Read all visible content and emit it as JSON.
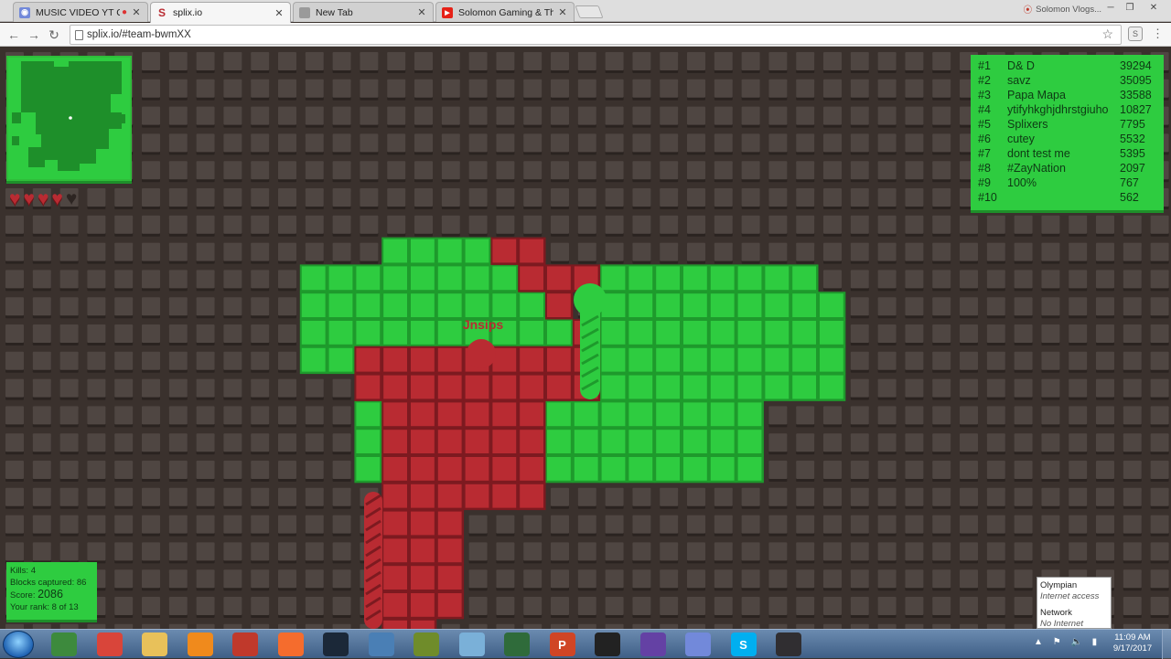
{
  "browser": {
    "tabs": [
      {
        "title": "MUSIC VIDEO YT CHA",
        "icon": "discord-icon",
        "color": "#7289da",
        "active": false,
        "audio": true
      },
      {
        "title": "splix.io",
        "icon": "splix-icon",
        "color": "#b92b32",
        "active": true,
        "audio": false
      },
      {
        "title": "New Tab",
        "icon": "new-tab-icon",
        "color": "#888888",
        "active": false,
        "audio": false
      },
      {
        "title": "Solomon Gaming & Thi",
        "icon": "youtube-icon",
        "color": "#e62117",
        "active": false,
        "audio": false
      }
    ],
    "profile_name": "Solomon Vlogs...",
    "url": "splix.io/#team-bwmXX",
    "extension_label": "S"
  },
  "game": {
    "colors": {
      "background": "#3a312d",
      "green": "#2ecc40",
      "green_dark": "#1e9a2c",
      "red": "#b92b32",
      "red_dark": "#7d1a20"
    },
    "player_name": "Jnsips",
    "lives_total": 5,
    "lives_remaining": 4,
    "leaderboard": [
      {
        "rank": "#1",
        "name": "D& D",
        "score": "39294"
      },
      {
        "rank": "#2",
        "name": "savz",
        "score": "35095"
      },
      {
        "rank": "#3",
        "name": "Papa Mapa",
        "score": "33588"
      },
      {
        "rank": "#4",
        "name": "ytifyhkghjdhrstgiuho",
        "score": "10827"
      },
      {
        "rank": "#5",
        "name": "Splixers",
        "score": "7795"
      },
      {
        "rank": "#6",
        "name": "cutey",
        "score": "5532"
      },
      {
        "rank": "#7",
        "name": "dont test me",
        "score": "5395"
      },
      {
        "rank": "#8",
        "name": "#ZayNation",
        "score": "2097"
      },
      {
        "rank": "#9",
        "name": "100%",
        "score": "767"
      },
      {
        "rank": "#10",
        "name": "",
        "score": "562"
      }
    ],
    "stats": {
      "kills": "Kills: 4",
      "blocks": "Blocks captured: 86",
      "score_label": "Score:",
      "score_value": "2086",
      "rank": "Your rank: 8 of 13"
    }
  },
  "network_tooltip": {
    "name1": "Olympian",
    "status1": "Internet access",
    "name2": "Network",
    "status2": "No Internet access"
  },
  "taskbar": {
    "apps": [
      {
        "icon": "tree-icon",
        "color": "#3d8a3d",
        "label": ""
      },
      {
        "icon": "chrome-icon",
        "color": "#d9453a",
        "label": ""
      },
      {
        "icon": "folder-icon",
        "color": "#e8c15a",
        "label": ""
      },
      {
        "icon": "media-player-icon",
        "color": "#f08a1c",
        "label": ""
      },
      {
        "icon": "snipping-tool-icon",
        "color": "#c0392b",
        "label": ""
      },
      {
        "icon": "origin-icon",
        "color": "#f56c2d",
        "label": ""
      },
      {
        "icon": "steam-icon",
        "color": "#1b2838",
        "label": ""
      },
      {
        "icon": "network-settings-icon",
        "color": "#4a7fb5",
        "label": ""
      },
      {
        "icon": "game-character-icon",
        "color": "#6f8c2a",
        "label": ""
      },
      {
        "icon": "paint-icon",
        "color": "#7ab0d8",
        "label": ""
      },
      {
        "icon": "game-window-icon",
        "color": "#2f6b3a",
        "label": ""
      },
      {
        "icon": "powerpoint-icon",
        "color": "#d04525",
        "label": "P"
      },
      {
        "icon": "stick-figure-icon",
        "color": "#222222",
        "label": ""
      },
      {
        "icon": "twitch-icon",
        "color": "#6441a4",
        "label": ""
      },
      {
        "icon": "discord-icon",
        "color": "#7289da",
        "label": ""
      },
      {
        "icon": "skype-icon",
        "color": "#00aff0",
        "label": "S"
      },
      {
        "icon": "obs-icon",
        "color": "#302e31",
        "label": ""
      }
    ],
    "time": "11:09 AM",
    "date": "9/17/2017"
  }
}
